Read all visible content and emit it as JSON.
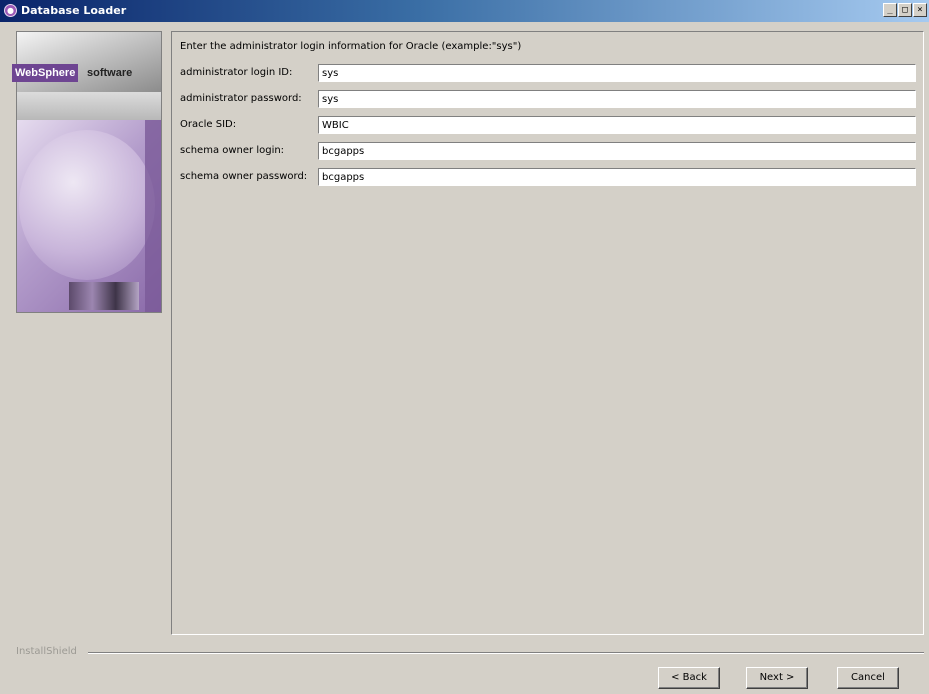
{
  "window": {
    "title": "Database Loader",
    "controls": [
      "_",
      "□",
      "×"
    ]
  },
  "banner": {
    "brand": "WebSphere",
    "product": "software"
  },
  "form": {
    "instructions": "Enter the administrator login information for Oracle (example:\"sys\")",
    "fields": [
      {
        "label": "administrator login ID:",
        "value": "sys"
      },
      {
        "label": "administrator password:",
        "value": "sys"
      },
      {
        "label": "Oracle SID:",
        "value": "WBIC"
      },
      {
        "label": "schema owner login:",
        "value": "bcgapps"
      },
      {
        "label": "schema owner password:",
        "value": "bcgapps"
      }
    ]
  },
  "footer": {
    "installer_label": "InstallShield",
    "back_label": "< Back",
    "next_label": "Next >",
    "cancel_label": "Cancel"
  }
}
